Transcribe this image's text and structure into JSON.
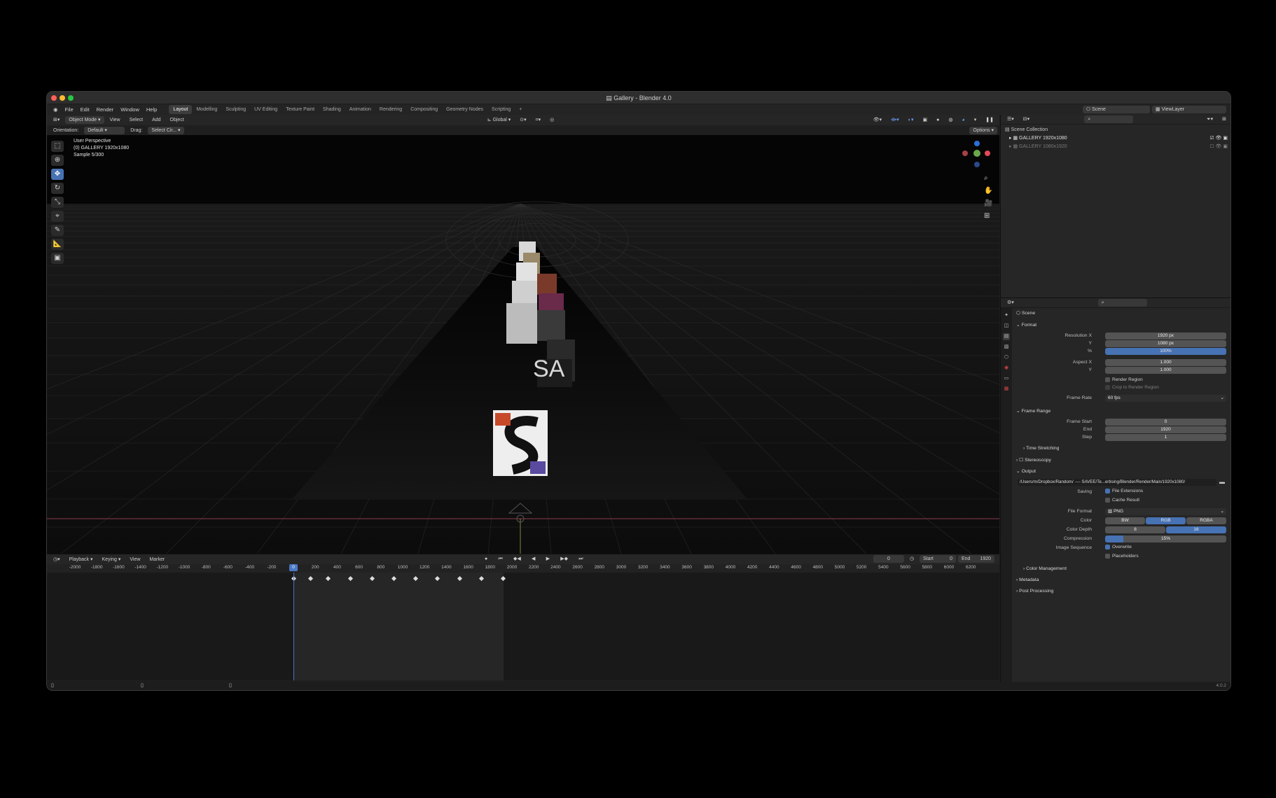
{
  "window": {
    "title": "Gallery - Blender 4.0"
  },
  "menu": {
    "file": "File",
    "edit": "Edit",
    "render": "Render",
    "window": "Window",
    "help": "Help"
  },
  "workspaces": [
    "Layout",
    "Modelling",
    "Sculpting",
    "UV Editing",
    "Texture Paint",
    "Shading",
    "Animation",
    "Rendering",
    "Compositing",
    "Geometry Nodes",
    "Scripting"
  ],
  "topright": {
    "scene": "Scene",
    "view_layer": "ViewLayer"
  },
  "viewport_header": {
    "mode": "Object Mode",
    "view": "View",
    "select": "Select",
    "add": "Add",
    "object": "Object",
    "transform": "Global",
    "options": "Options"
  },
  "viewport_sub": {
    "orientation_label": "Orientation:",
    "orientation": "Default",
    "drag_label": "Drag:",
    "drag": "Select Cir..."
  },
  "viewport_info": {
    "line1": "User Perspective",
    "line2": "(0) GALLERY 1920x1080",
    "line3": "Sample 5/300"
  },
  "viewport_scene": {
    "poster_text": "SA"
  },
  "outliner": {
    "root": "Scene Collection",
    "items": [
      "GALLERY 1920x1080",
      "GALLERY 1080x1920"
    ]
  },
  "props": {
    "scene": "Scene",
    "format": "Format",
    "resolution_x_label": "Resolution X",
    "resolution_x": "1920 px",
    "y_label": "Y",
    "resolution_y": "1080 px",
    "pct_label": "%",
    "pct": "100%",
    "aspect_x_label": "Aspect X",
    "aspect_x": "1.000",
    "aspect_y_label": "Y",
    "aspect_y": "1.000",
    "render_region": "Render Region",
    "crop_region": "Crop to Render Region",
    "frame_rate_label": "Frame Rate",
    "frame_rate": "60 fps",
    "frame_range": "Frame Range",
    "frame_start_label": "Frame Start",
    "frame_start": "0",
    "end_label": "End",
    "end": "1920",
    "step_label": "Step",
    "step": "1",
    "time_stretching": "Time Stretching",
    "stereoscopy": "Stereoscopy",
    "output": "Output",
    "output_path": "/Users/m/Dropbox/Random/ ·--- SAVEE/Te...ertising/Blender/Render/Main/1920x1080/",
    "saving_label": "Saving",
    "file_extensions": "File Extensions",
    "cache_result": "Cache Result",
    "file_format_label": "File Format",
    "file_format": "PNG",
    "color_label": "Color",
    "color_bw": "BW",
    "color_rgb": "RGB",
    "color_rgba": "RGBA",
    "color_depth_label": "Color Depth",
    "depth_8": "8",
    "depth_16": "16",
    "compression_label": "Compression",
    "compression": "15%",
    "image_sequence_label": "Image Sequence",
    "overwrite": "Overwrite",
    "placeholders": "Placeholders",
    "color_management": "Color Management",
    "metadata": "Metadata",
    "post_processing": "Post Processing"
  },
  "timeline": {
    "playback": "Playback",
    "keying": "Keying",
    "view": "View",
    "marker": "Marker",
    "current_frame": "0",
    "start_label": "Start",
    "start": "0",
    "end_label": "End",
    "end": "1920",
    "ruler": [
      "-2000",
      "-1800",
      "-1600",
      "-1400",
      "-1200",
      "-1000",
      "-800",
      "-600",
      "-400",
      "-200",
      "0",
      "200",
      "400",
      "600",
      "800",
      "1000",
      "1200",
      "1400",
      "1600",
      "1800",
      "2000",
      "2200",
      "2400",
      "2600",
      "2800",
      "3000",
      "3200",
      "3400",
      "3600",
      "3800",
      "4000",
      "4200",
      "4400",
      "4600",
      "4800",
      "5000",
      "5200",
      "5400",
      "5600",
      "5800",
      "6000",
      "6200"
    ],
    "keyframes": [
      0,
      160,
      320,
      520,
      720,
      920,
      1120,
      1320,
      1520,
      1720,
      1920
    ]
  },
  "status": {
    "version": "4.0.2"
  },
  "colors": {
    "accent": "#4772b3",
    "bg": "#1d1d1d",
    "panel": "#262626"
  }
}
